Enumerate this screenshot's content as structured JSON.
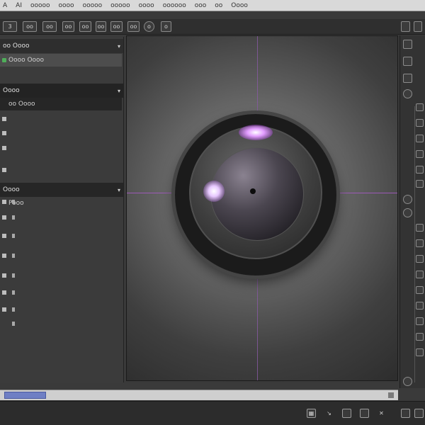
{
  "menubar": {
    "items": [
      "A",
      "AI",
      "ooooo",
      "oooo",
      "ooooo",
      "ooooo",
      "oooo",
      "oooooo",
      "ooo",
      "oo",
      "Oooo"
    ]
  },
  "toolbar": {
    "buttons": [
      {
        "label": "3",
        "icon": "tool-icon"
      },
      {
        "label": "oo",
        "icon": "tool-icon"
      },
      {
        "label": "oo",
        "icon": "tool-icon"
      },
      {
        "label": "oo",
        "icon": "tool-icon"
      },
      {
        "label": "oo",
        "icon": "tool-icon"
      },
      {
        "label": "oo",
        "icon": "tool-icon"
      },
      {
        "label": "oo",
        "icon": "tool-icon"
      },
      {
        "label": "oo",
        "icon": "tool-icon"
      },
      {
        "label": "o",
        "icon": "circle-icon"
      },
      {
        "label": "o",
        "icon": "tool-icon"
      }
    ]
  },
  "left_panel": {
    "section1_title": "oo Oooo",
    "section1_item": "Oooo Oooo",
    "section2_title": "Oooo",
    "section2_item": "oo Oooo",
    "section3_title": "Oooo",
    "section3_item": "Pooo"
  },
  "timeline": {
    "progress": 0.11
  },
  "bottombar": {
    "icons": [
      "grid-icon",
      "select-icon",
      "frame-icon",
      "frame-icon",
      "text-icon",
      "frame-icon",
      "frame-icon"
    ]
  }
}
